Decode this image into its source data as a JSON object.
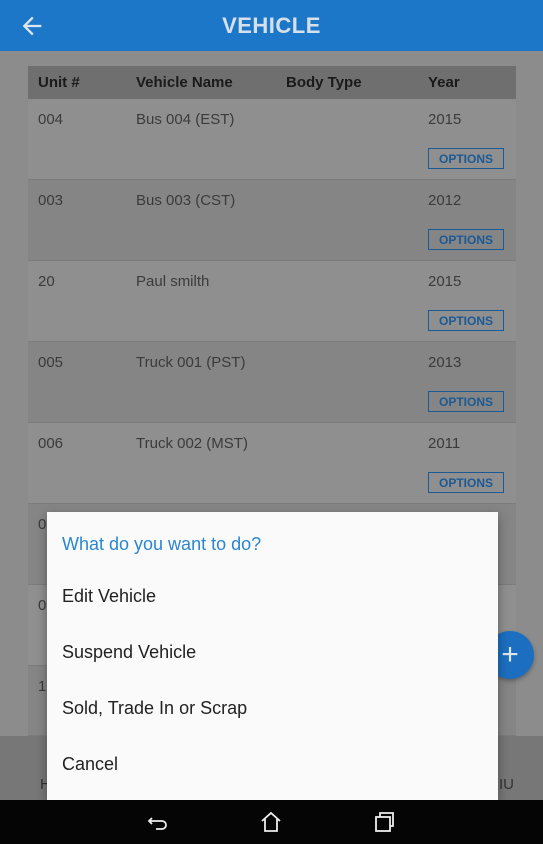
{
  "appbar": {
    "title": "VEHICLE",
    "back_icon": "arrow-left-icon"
  },
  "table": {
    "headers": {
      "unit": "Unit #",
      "name": "Vehicle Name",
      "body": "Body Type",
      "year": "Year"
    },
    "rows": [
      {
        "unit": "004",
        "name": "Bus 004 (EST)",
        "body": "",
        "year": "2015",
        "action": "OPTIONS"
      },
      {
        "unit": "003",
        "name": "Bus 003 (CST)",
        "body": "",
        "year": "2012",
        "action": "OPTIONS"
      },
      {
        "unit": "20",
        "name": "Paul smilth",
        "body": "",
        "year": "2015",
        "action": "OPTIONS"
      },
      {
        "unit": "005",
        "name": "Truck 001 (PST)",
        "body": "",
        "year": "2013",
        "action": "OPTIONS"
      },
      {
        "unit": "006",
        "name": "Truck 002 (MST)",
        "body": "",
        "year": "2011",
        "action": "OPTIONS"
      }
    ],
    "partial_rows": [
      "0",
      "0",
      "1"
    ]
  },
  "bottom_nav": {
    "left_partial": "H",
    "right_partial": "IU"
  },
  "fab": {
    "icon": "plus-icon",
    "label": "+"
  },
  "dialog": {
    "title": "What do you want to do?",
    "items": [
      "Edit Vehicle",
      "Suspend Vehicle",
      "Sold, Trade In or Scrap",
      "Cancel"
    ]
  },
  "system_nav": {
    "back": "back-icon",
    "home": "home-icon",
    "recents": "recents-icon"
  },
  "colors": {
    "primary": "#1c77c9",
    "dialog_title": "#2a86d1",
    "button_border": "#1c5a95"
  }
}
